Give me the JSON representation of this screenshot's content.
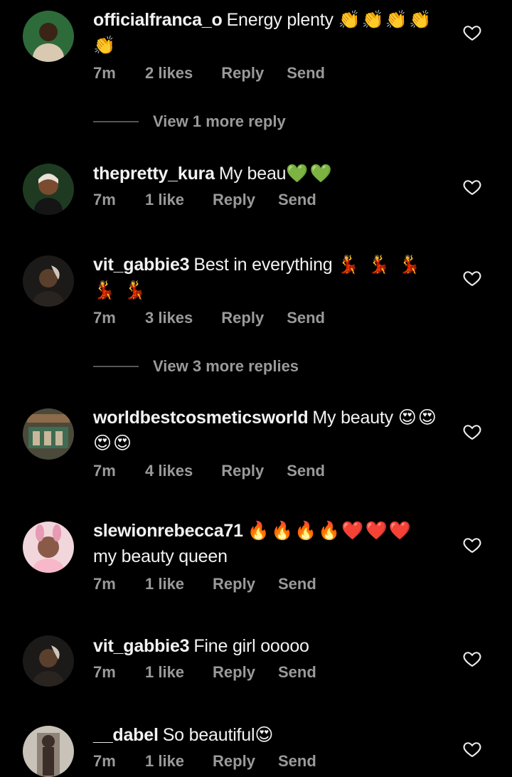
{
  "comments": [
    {
      "username": "officialfranca_o",
      "text": "Energy plenty",
      "emoji": "👏👏👏👏👏",
      "time": "7m",
      "likes": "2 likes",
      "reply": "Reply",
      "send": "Send",
      "view_more": "View 1 more reply",
      "avatar_colors": [
        "#2e6b3a",
        "#d9c9b0",
        "#3a2416"
      ]
    },
    {
      "username": "thepretty_kura",
      "text": "My beau",
      "emoji": "💚💚",
      "time": "7m",
      "likes": "1 like",
      "reply": "Reply",
      "send": "Send",
      "avatar_colors": [
        "#1e3b22",
        "#7a4b2f",
        "#e8e1d6"
      ]
    },
    {
      "username": "vit_gabbie3",
      "text": "Best in everything",
      "emoji": "💃 💃 💃 💃 💃",
      "time": "7m",
      "likes": "3 likes",
      "reply": "Reply",
      "send": "Send",
      "view_more": "View 3 more replies",
      "avatar_colors": [
        "#1c1a18",
        "#5a3f2c",
        "#cfc7bc"
      ]
    },
    {
      "username": "worldbestcosmeticsworld",
      "text": "My beauty",
      "emoji": "😍😍😍😍",
      "time": "7m",
      "likes": "4 likes",
      "reply": "Reply",
      "send": "Send",
      "avatar_colors": [
        "#4b4a3a",
        "#8c6a4a",
        "#3f6c53"
      ]
    },
    {
      "username": "slewionrebecca71",
      "text": "my beauty queen",
      "emoji": "🔥🔥🔥🔥❤️❤️❤️",
      "time": "7m",
      "likes": "1 like",
      "reply": "Reply",
      "send": "Send",
      "avatar_colors": [
        "#f1d6dc",
        "#e79ab3",
        "#8a5a48"
      ]
    },
    {
      "username": "vit_gabbie3",
      "text": "Fine girl ooooo",
      "emoji": "",
      "time": "7m",
      "likes": "1 like",
      "reply": "Reply",
      "send": "Send",
      "avatar_colors": [
        "#1c1a18",
        "#5a3f2c",
        "#cfc7bc"
      ]
    },
    {
      "username": "__dabel",
      "text": "So beautiful",
      "emoji": "😍",
      "time": "7m",
      "likes": "1 like",
      "reply": "Reply",
      "send": "Send",
      "avatar_colors": [
        "#c8c2b8",
        "#3b2d28",
        "#8f8378"
      ]
    }
  ],
  "icons": {
    "like": "heart-outline-icon"
  }
}
